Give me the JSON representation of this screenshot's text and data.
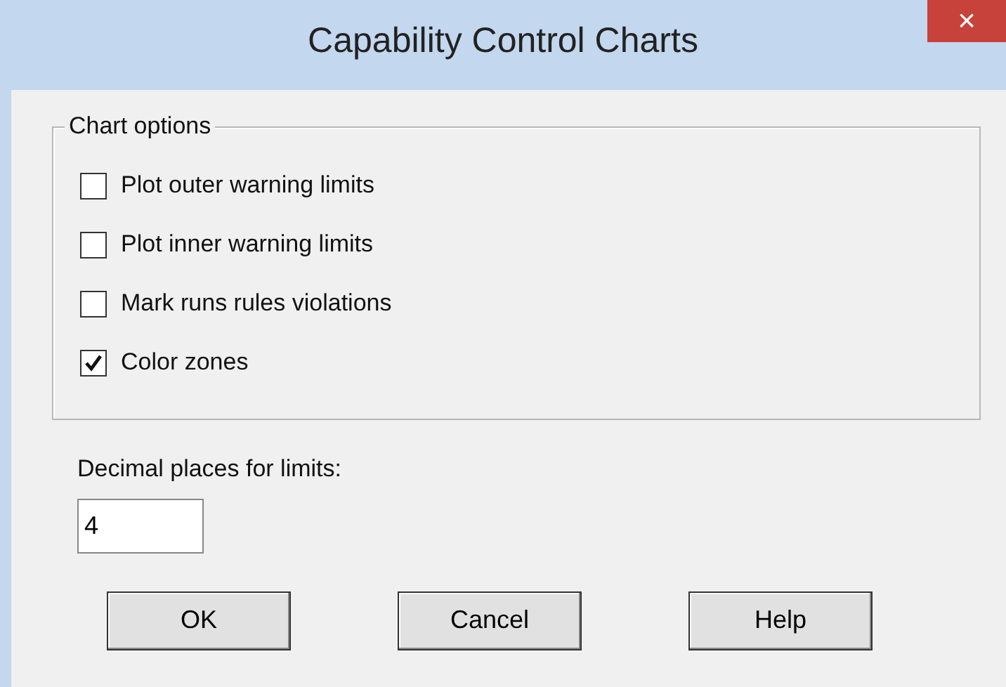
{
  "window": {
    "title": "Capability Control Charts",
    "close": "×"
  },
  "group": {
    "legend": "Chart options",
    "options": [
      {
        "label": "Plot outer warning limits",
        "checked": false
      },
      {
        "label": "Plot inner warning limits",
        "checked": false
      },
      {
        "label": "Mark runs rules violations",
        "checked": false
      },
      {
        "label": "Color zones",
        "checked": true
      }
    ]
  },
  "decimal_field": {
    "label": "Decimal places for limits:",
    "value": "4"
  },
  "buttons": [
    "OK",
    "Cancel",
    "Help"
  ]
}
